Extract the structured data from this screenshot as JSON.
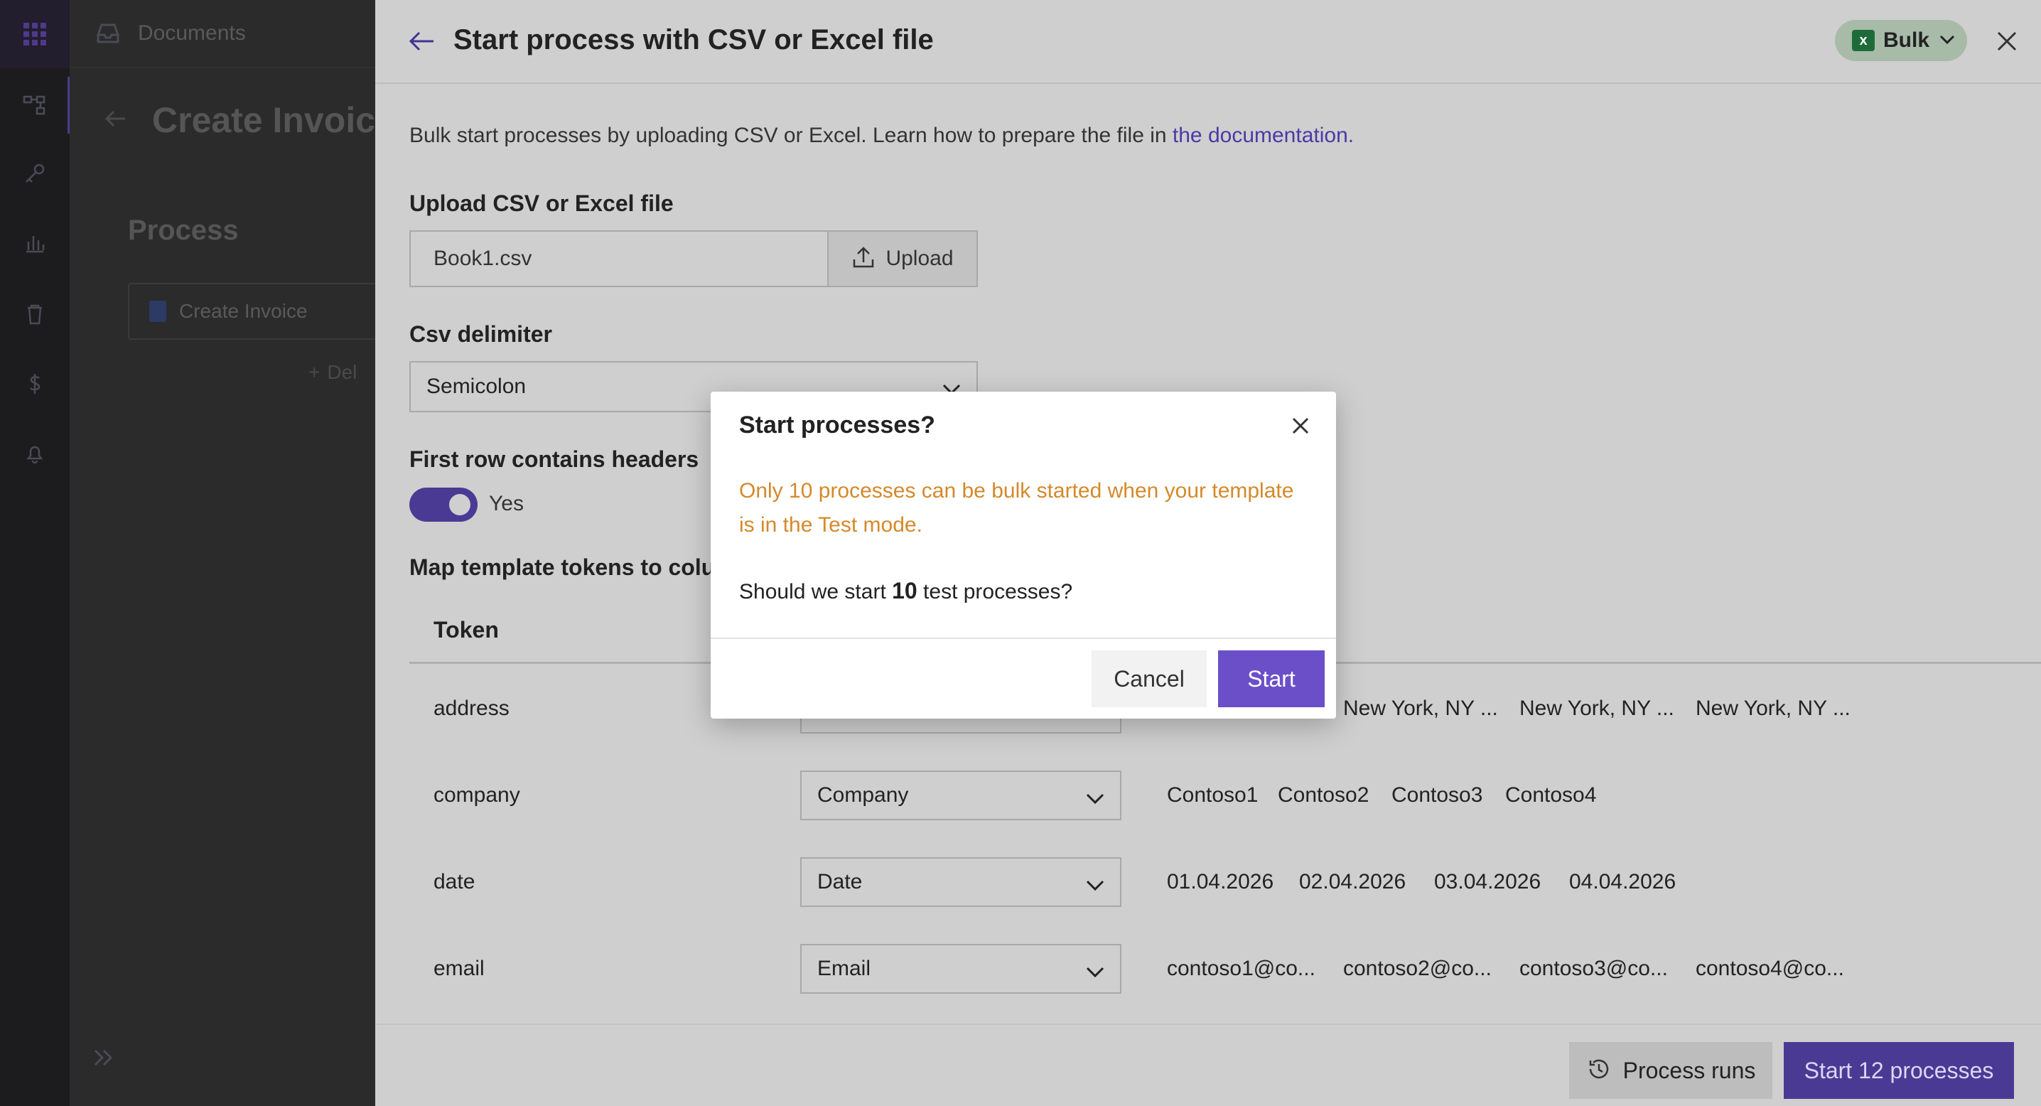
{
  "app": {
    "breadcrumb": "Documents",
    "page_title": "Create Invoice",
    "section_title": "Process",
    "process_card_label": "Create Invoice",
    "delete_label": "Del"
  },
  "panel": {
    "title": "Start process with CSV or Excel file",
    "bulk_label": "Bulk",
    "intro_text": "Bulk start processes by uploading CSV or Excel. Learn how to prepare the file in ",
    "intro_link": "the documentation.",
    "upload_section_label": "Upload CSV or Excel file",
    "file_name": "Book1.csv",
    "upload_button": "Upload",
    "delimiter_label": "Csv delimiter",
    "delimiter_value": "Semicolon",
    "headers_label": "First row contains headers",
    "headers_toggle_label": "Yes",
    "headers_toggle_on": true,
    "map_label": "Map template tokens to colu",
    "table": {
      "column_token": "Token",
      "rows": [
        {
          "token": "address",
          "column": "",
          "values": [
            "",
            "New York, NY ...",
            "New York, NY ...",
            "New York, NY ..."
          ]
        },
        {
          "token": "company",
          "column": "Company",
          "values": [
            "Contoso1",
            "Contoso2",
            "Contoso3",
            "Contoso4"
          ]
        },
        {
          "token": "date",
          "column": "Date",
          "values": [
            "01.04.2026",
            "02.04.2026",
            "03.04.2026",
            "04.04.2026"
          ]
        },
        {
          "token": "email",
          "column": "Email",
          "values": [
            "contoso1@co...",
            "contoso2@co...",
            "contoso3@co...",
            "contoso4@co..."
          ]
        }
      ]
    },
    "footer": {
      "process_runs": "Process runs",
      "start_all": "Start 12 processes"
    }
  },
  "modal": {
    "title": "Start processes?",
    "warning": "Only 10 processes can be bulk started when your template is in the Test mode.",
    "question_prefix": "Should we start ",
    "question_count": "10",
    "question_suffix": " test processes?",
    "cancel": "Cancel",
    "start": "Start"
  },
  "colors": {
    "accent": "#6a4fc9",
    "warning": "#d4892a",
    "link": "#4a3aa6"
  }
}
